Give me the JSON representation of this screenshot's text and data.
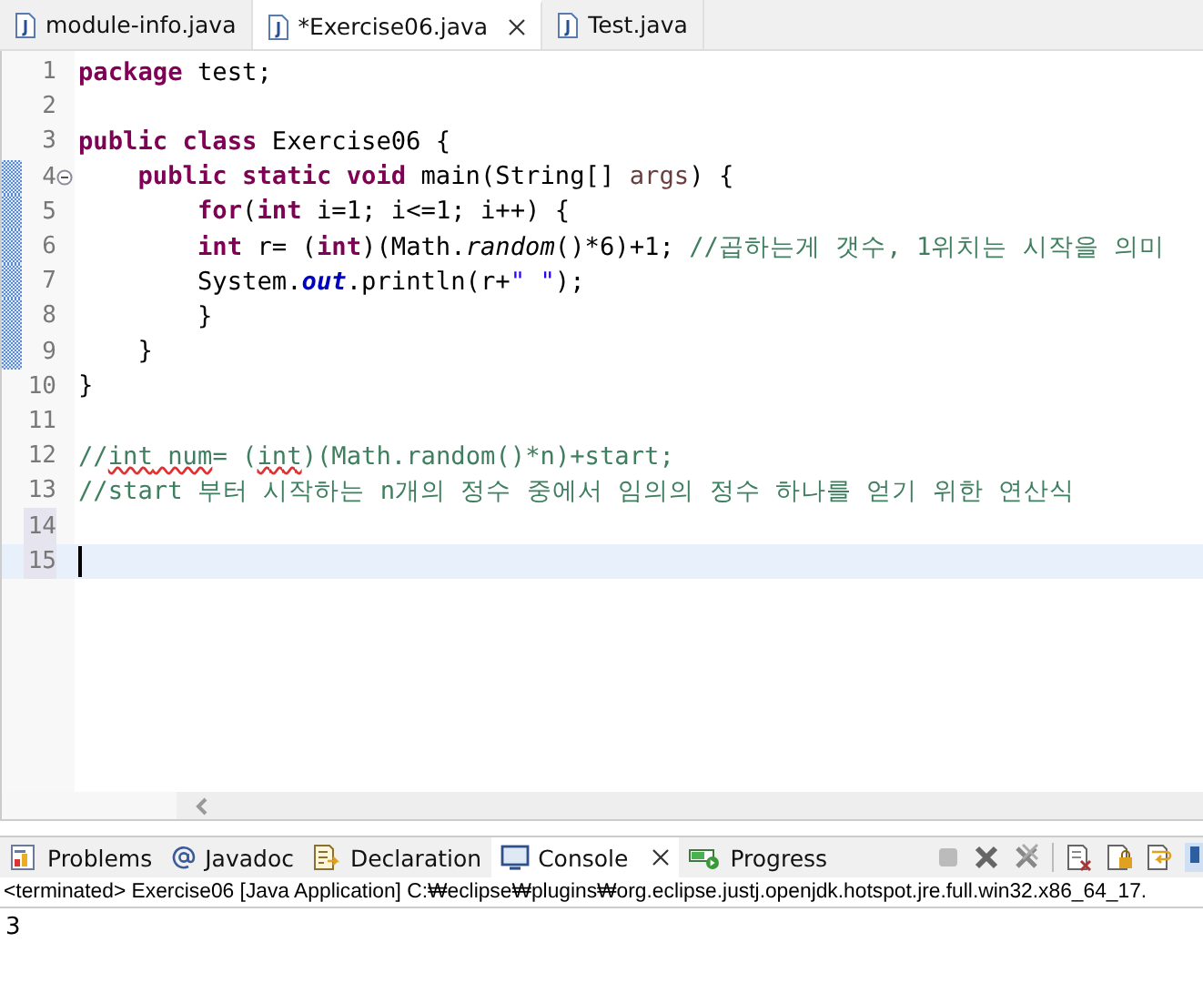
{
  "editor_tabs": [
    {
      "label": "module-info.java",
      "selected": false,
      "closable": false
    },
    {
      "label": "*Exercise06.java",
      "selected": true,
      "closable": true
    },
    {
      "label": "Test.java",
      "selected": false,
      "closable": false
    }
  ],
  "code_lines": [
    {
      "number": "1",
      "tokens": [
        {
          "kind": "keyword",
          "text": "package"
        },
        {
          "kind": "plain",
          "text": " test;"
        }
      ]
    },
    {
      "number": "2"
    },
    {
      "number": "3",
      "tokens": [
        {
          "kind": "keyword",
          "text": "public class"
        },
        {
          "kind": "plain",
          "text": " Exercise06 {"
        }
      ]
    },
    {
      "number": "4",
      "folding": true,
      "changed": true,
      "tokens": [
        {
          "kind": "keyword",
          "text": "    public static void"
        },
        {
          "kind": "plain",
          "text": " main(String[] "
        },
        {
          "kind": "param",
          "text": "args"
        },
        {
          "kind": "plain",
          "text": ") {"
        }
      ]
    },
    {
      "number": "5",
      "changed": true,
      "tokens": [
        {
          "kind": "keyword",
          "text": "        for"
        },
        {
          "kind": "plain",
          "text": "("
        },
        {
          "kind": "keyword",
          "text": "int"
        },
        {
          "kind": "plain",
          "text": " i=1; i<=1; i++) {"
        }
      ]
    },
    {
      "number": "6",
      "changed": true,
      "tokens": [
        {
          "kind": "keyword",
          "text": "        int"
        },
        {
          "kind": "plain",
          "text": " r= ("
        },
        {
          "kind": "keyword",
          "text": "int"
        },
        {
          "kind": "plain",
          "text": ")(Math."
        },
        {
          "kind": "static-method",
          "text": "random"
        },
        {
          "kind": "plain",
          "text": "()*6)+1; "
        },
        {
          "kind": "comment",
          "text": "//곱하는게 갯수, 1위치는 시작을 의미"
        }
      ]
    },
    {
      "number": "7",
      "changed": true,
      "tokens": [
        {
          "kind": "plain",
          "text": "        System."
        },
        {
          "kind": "static-field",
          "text": "out"
        },
        {
          "kind": "plain",
          "text": ".println(r+"
        },
        {
          "kind": "string",
          "text": "\" \""
        },
        {
          "kind": "plain",
          "text": ");"
        }
      ]
    },
    {
      "number": "8",
      "changed": true,
      "tokens": [
        {
          "kind": "plain",
          "text": "        }"
        }
      ]
    },
    {
      "number": "9",
      "changed": true,
      "tokens": [
        {
          "kind": "plain",
          "text": "    }"
        }
      ]
    },
    {
      "number": "10",
      "tokens": [
        {
          "kind": "plain",
          "text": "}"
        }
      ]
    },
    {
      "number": "11"
    },
    {
      "number": "12",
      "tokens": [
        {
          "kind": "comment",
          "text": "//"
        },
        {
          "kind": "comment-warning",
          "text": "int"
        },
        {
          "kind": "comment-warning",
          "text": " num"
        },
        {
          "kind": "comment",
          "text": "= ("
        },
        {
          "kind": "comment-warning",
          "text": "int"
        },
        {
          "kind": "comment",
          "text": ")(Math.random()*n)+start;"
        }
      ]
    },
    {
      "number": "13",
      "tokens": [
        {
          "kind": "comment",
          "text": "//start 부터 시작하는 n개의 정수 중에서 임의의 정수 하나를 얻기 위한 연산식"
        }
      ]
    },
    {
      "number": "14",
      "marked": true
    },
    {
      "number": "15",
      "marked": true,
      "current": true
    }
  ],
  "view_tabs": [
    {
      "label": "Problems",
      "selected": false,
      "closable": false
    },
    {
      "label": "Javadoc",
      "selected": false,
      "closable": false
    },
    {
      "label": "Declaration",
      "selected": false,
      "closable": false
    },
    {
      "label": "Console",
      "selected": true,
      "closable": true
    },
    {
      "label": "Progress",
      "selected": false,
      "closable": false
    }
  ],
  "console": {
    "status": "<terminated> Exercise06 [Java Application] C:₩eclipse₩plugins₩org.eclipse.justj.openjdk.hotspot.jre.full.win32.x86_64_17.",
    "output": "3"
  }
}
